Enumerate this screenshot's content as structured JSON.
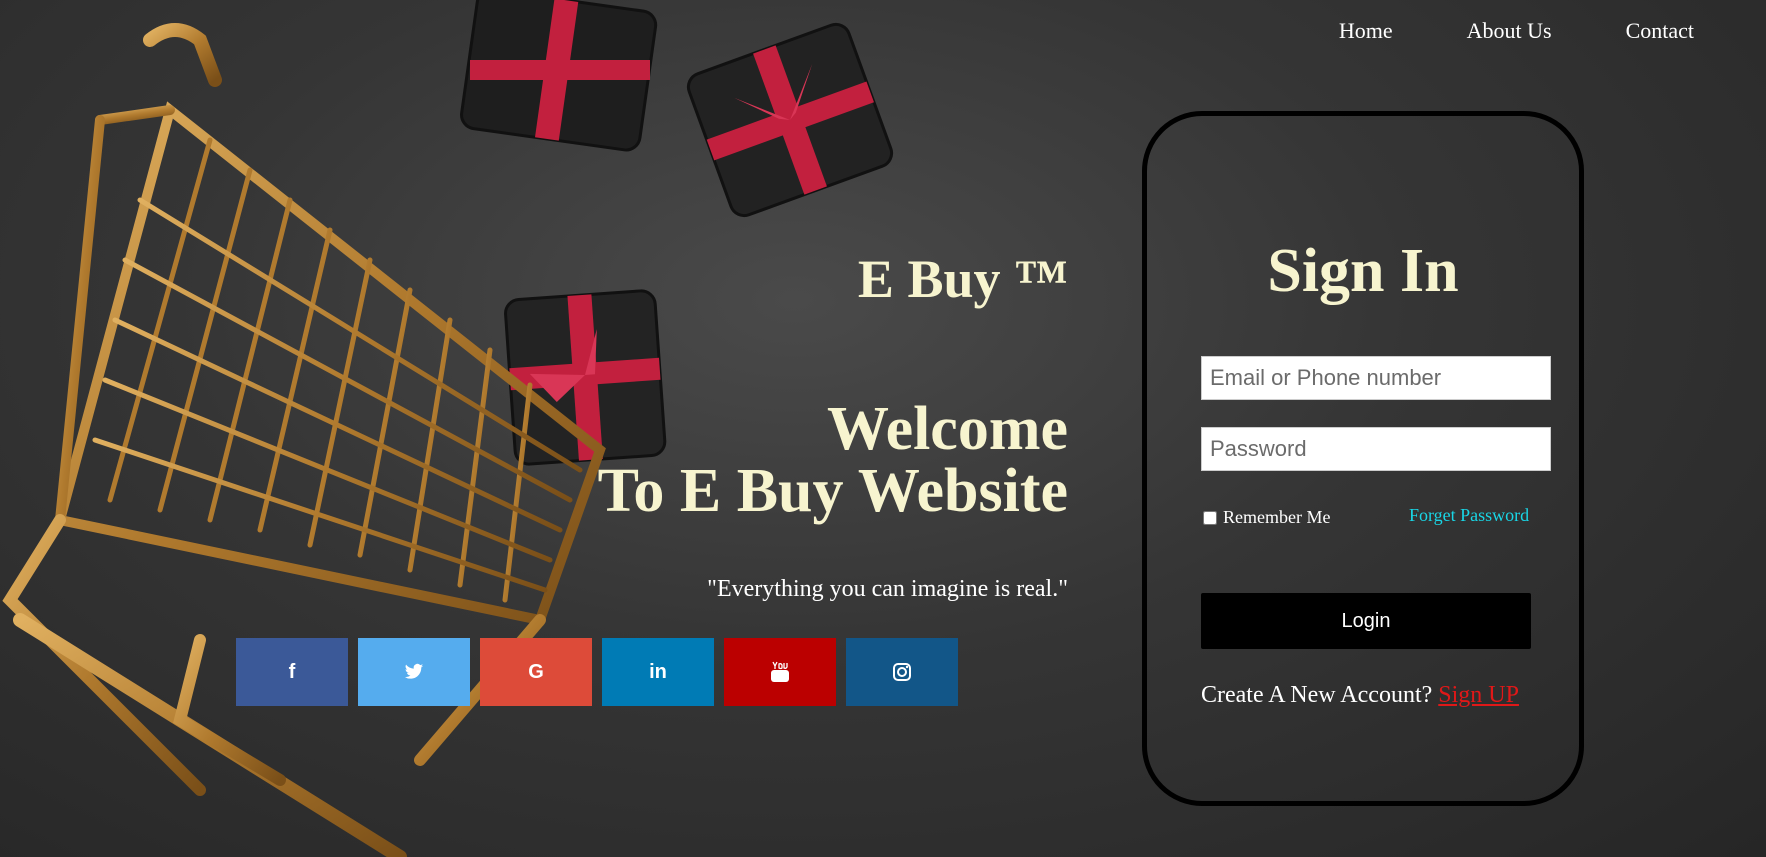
{
  "nav": {
    "items": [
      "Home",
      "About Us",
      "Contact"
    ]
  },
  "hero": {
    "brand": "E Buy ™",
    "welcome_line1": "Welcome",
    "welcome_line2": "To E Buy Website",
    "quote": "\"Everything you can imagine is real.\""
  },
  "social": [
    {
      "icon": "facebook-icon",
      "glyph": "f",
      "color": "#3b5998"
    },
    {
      "icon": "twitter-icon",
      "glyph": "t",
      "color": "#55acee"
    },
    {
      "icon": "google-icon",
      "glyph": "G",
      "color": "#dd4b39"
    },
    {
      "icon": "linkedin-icon",
      "glyph": "in",
      "color": "#007bb5"
    },
    {
      "icon": "youtube-icon",
      "glyph": "▶",
      "color": "#bb0000"
    },
    {
      "icon": "instagram-icon",
      "glyph": "◎",
      "color": "#125688"
    }
  ],
  "signin": {
    "title": "Sign In",
    "email_placeholder": "Email or Phone number",
    "password_placeholder": "Password",
    "remember_label": "Remember Me",
    "forgot_label": "Forget Password",
    "login_label": "Login",
    "create_text": "Create A New Account?",
    "signup_label": "Sign UP"
  },
  "colors": {
    "heading": "#f7f4cf",
    "link_cyan": "#19d6e6",
    "signup_red": "#e01818"
  }
}
